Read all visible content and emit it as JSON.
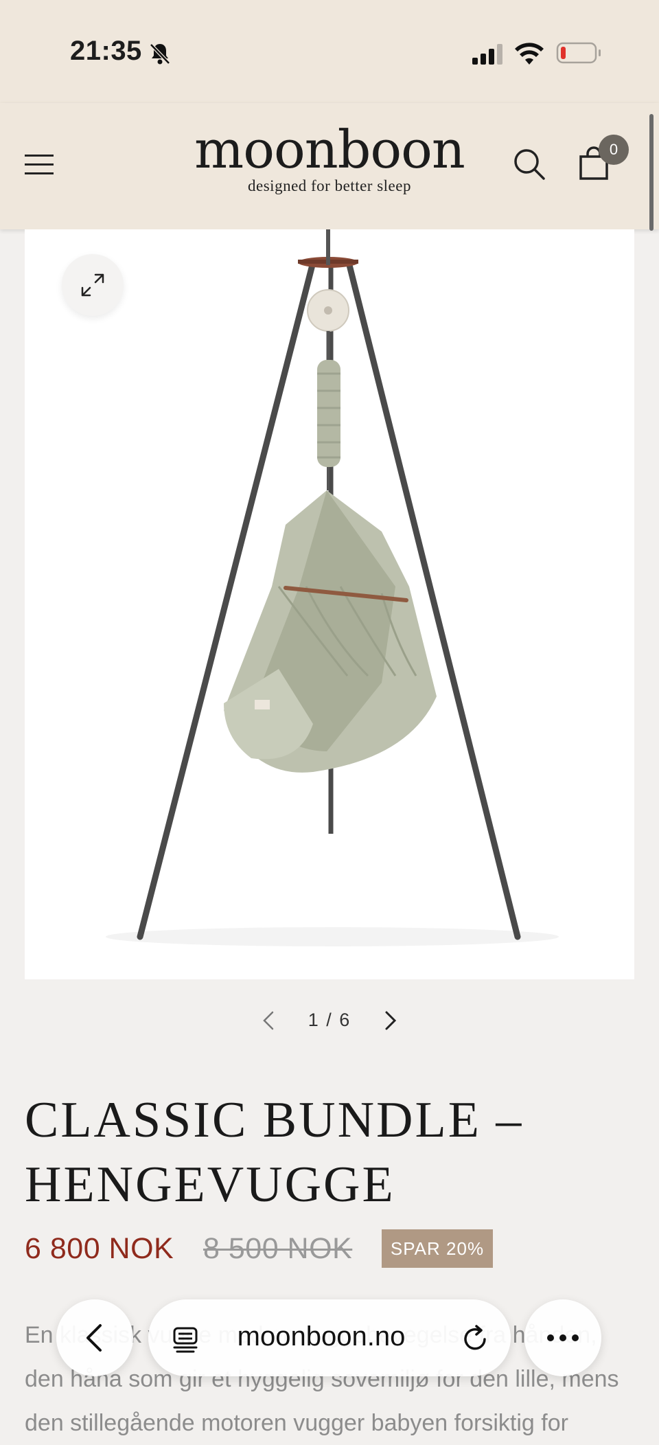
{
  "status_bar": {
    "time": "21:35",
    "icons": [
      "bell-slash-icon",
      "cellular-signal-icon",
      "wifi-icon",
      "battery-low-icon"
    ]
  },
  "header": {
    "logo": "moonboon",
    "tagline": "designed for better sleep",
    "cart_count": "0",
    "icons": [
      "menu-icon",
      "search-icon",
      "cart-icon"
    ]
  },
  "gallery": {
    "counter": "1 / 6",
    "current": 1,
    "total": 6,
    "icons": [
      "expand-icon",
      "chevron-left-icon",
      "chevron-right-icon"
    ]
  },
  "product": {
    "title": "CLASSIC BUNDLE – HENGEVUGGE",
    "price": "6 800 NOK",
    "old_price": "8 500 NOK",
    "badge": "SPAR 20%",
    "description": "En klassisk vugge med en vuggebevegelse fra hånden, den håna som gir et hyggelig sovemiljø for den lille, mens den stillegående motoren vugger babyen forsiktig for"
  },
  "browser": {
    "url": "moonboon.no",
    "icons": [
      "back-icon",
      "reader-icon",
      "reload-icon",
      "more-icon"
    ]
  },
  "colors": {
    "header_bg": "#efe7dc",
    "page_bg": "#f2f0ee",
    "sale_price": "#8f2a1c",
    "badge_bg": "#b09984",
    "cart_badge": "#6b665f"
  }
}
